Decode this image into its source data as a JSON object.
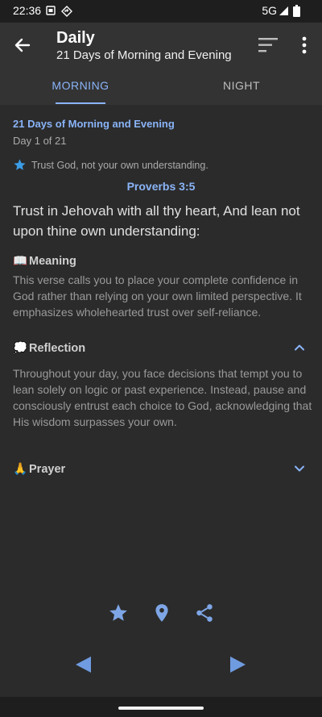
{
  "status_bar": {
    "time": "22:36",
    "network": "5G",
    "icons": [
      "sim-card-icon",
      "navigation-diamond-icon",
      "signal-icon",
      "battery-icon"
    ]
  },
  "app_bar": {
    "title": "Daily",
    "subtitle": "21 Days of Morning and Evening",
    "icons": [
      "back-arrow-icon",
      "sort-icon",
      "more-vert-icon"
    ]
  },
  "tabs": [
    {
      "label": "MORNING",
      "selected": true
    },
    {
      "label": "NIGHT",
      "selected": false
    }
  ],
  "content": {
    "series_title": "21 Days of Morning and Evening",
    "day_label": "Day 1 of 21",
    "theme": "Trust God, not your own understanding.",
    "reference": "Proverbs 3:5",
    "verse": "Trust in Jehovah with all thy heart, And lean not upon thine own understanding:"
  },
  "sections": {
    "meaning": {
      "emoji": "📖",
      "title": "Meaning",
      "body": "This verse calls you to place your complete confidence in God rather than relying on your own limited perspective. It emphasizes wholehearted trust over self-reliance."
    },
    "reflection": {
      "emoji": "💭",
      "title": "Reflection",
      "expanded": true,
      "body": "Throughout your day, you face decisions that tempt you to lean solely on logic or past experience. Instead, pause and consciously entrust each choice to God, acknowledging that His wisdom surpasses your own."
    },
    "prayer": {
      "emoji": "🙏",
      "title": "Prayer",
      "expanded": false
    }
  },
  "actions": [
    "star-icon",
    "location-pin-icon",
    "share-icon"
  ],
  "navigation": [
    "previous-triangle-icon",
    "next-triangle-icon"
  ],
  "colors": {
    "accent": "#8ab4f8",
    "background": "#2b2b2b",
    "app_bar": "#333333",
    "status_bar": "#1e1e1e",
    "action_icon": "#7ea6e6"
  }
}
